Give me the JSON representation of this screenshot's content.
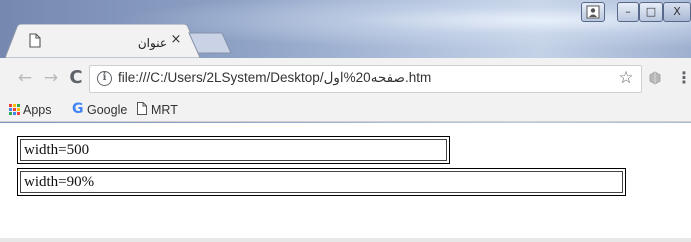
{
  "browser": {
    "tab": {
      "title": "عنوان",
      "close_glyph": "×",
      "page_icon": "page-icon"
    },
    "window_controls": {
      "user": "user-icon",
      "minimize": "–",
      "maximize": "□",
      "close": "X"
    },
    "toolbar": {
      "back_glyph": "←",
      "forward_glyph": "→",
      "reload_glyph": "C",
      "info_glyph": "i",
      "url": "file:///C:/Users/2LSystem/Desktop/صفحه20%اول.htm",
      "star_glyph": "☆",
      "menu_glyph": "⋮"
    },
    "bookmarks": [
      {
        "label": "Apps",
        "icon": "apps-grid-icon"
      },
      {
        "label": "Google",
        "icon": "google-icon"
      },
      {
        "label": "MRT",
        "icon": "page-icon"
      }
    ]
  },
  "page": {
    "box1_text": "width=500",
    "box2_text": "width=90%"
  },
  "colors": {
    "desktop_blue": "#8fa3c7",
    "chrome_toolbar": "#f2f2f2",
    "google_blue": "#4285f4"
  }
}
